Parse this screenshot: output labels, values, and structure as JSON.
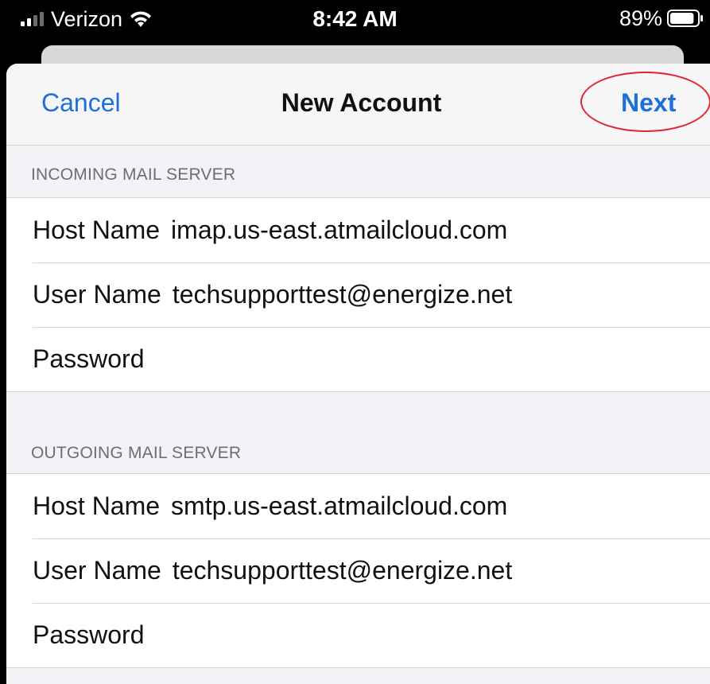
{
  "status_bar": {
    "carrier": "Verizon",
    "time": "8:42 AM",
    "battery": "89%",
    "signal_icon": "cellular-signal-icon",
    "wifi_icon": "wifi-icon",
    "battery_icon": "battery-icon",
    "battery_level": 0.89
  },
  "nav": {
    "cancel": "Cancel",
    "title": "New Account",
    "next": "Next",
    "highlight_color": "#e0242c",
    "accent_color": "#1e6fd9"
  },
  "incoming": {
    "header": "INCOMING MAIL SERVER",
    "host_label": "Host Name",
    "host_value": "imap.us-east.atmailcloud.com",
    "user_label": "User Name",
    "user_value": "techsupporttest@energize.net",
    "password_label": "Password",
    "password_value": ""
  },
  "outgoing": {
    "header": "OUTGOING MAIL SERVER",
    "host_label": "Host Name",
    "host_value": "smtp.us-east.atmailcloud.com",
    "user_label": "User Name",
    "user_value": "techsupporttest@energize.net",
    "password_label": "Password",
    "password_value": ""
  }
}
